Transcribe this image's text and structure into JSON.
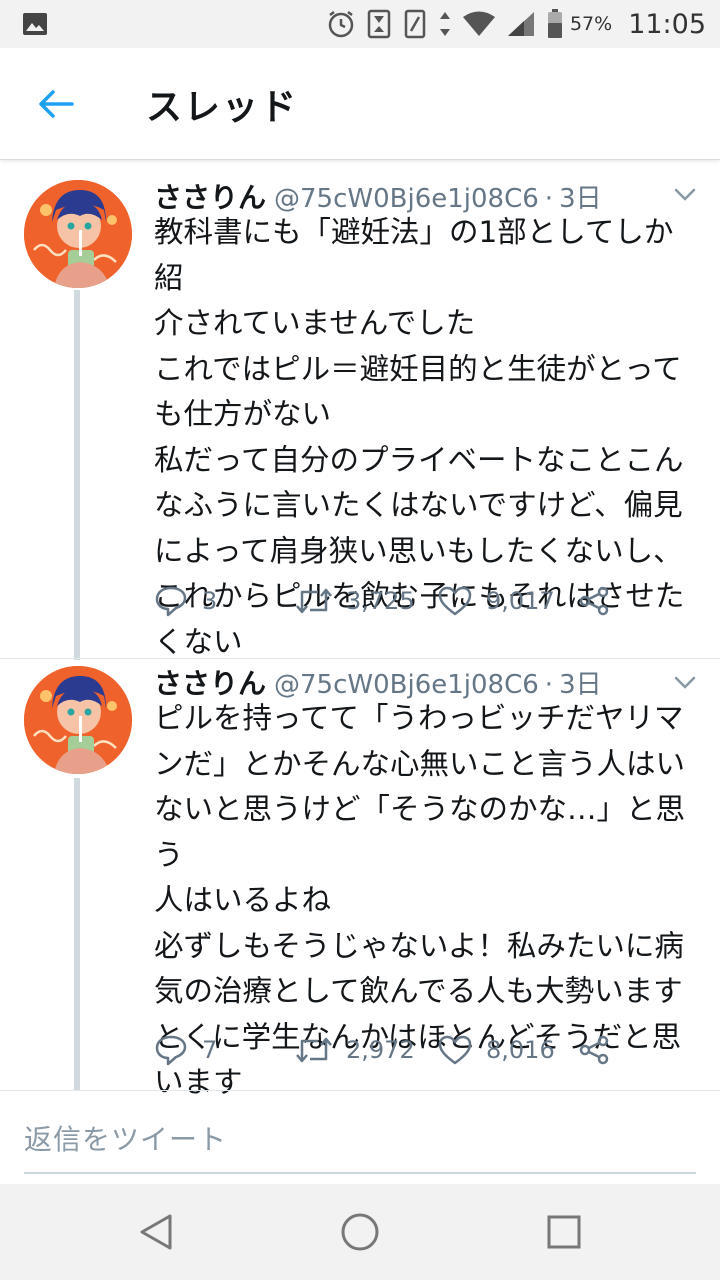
{
  "status_bar": {
    "battery_percent": "57%",
    "time": "11:05",
    "icons": [
      "image-icon",
      "alarm-icon",
      "hourglass-icon",
      "vibrate-icon",
      "data-arrows-icon",
      "wifi-icon",
      "signal-icon",
      "battery-icon"
    ]
  },
  "header": {
    "title": "スレッド",
    "back_icon": "back-arrow-icon",
    "accent_color": "#1da1f2"
  },
  "tweets": [
    {
      "display_name": "ささりん",
      "handle": "@75cW0Bj6e1j08C6",
      "separator": "·",
      "time": "3日",
      "text": "教科書にも「避妊法」の1部としてしか紹\n介されていませんでした\nこれではピル＝避妊目的と生徒がとって\nも仕方がない\n私だって自分のプライベートなことこん\nなふうに言いたくはないですけど、偏見\nによって肩身狭い思いもしたくないし、\nこれからピルを飲む子にもそれはさせた\nくない",
      "replies": "3",
      "retweets": "3,725",
      "likes": "9,017"
    },
    {
      "display_name": "ささりん",
      "handle": "@75cW0Bj6e1j08C6",
      "separator": "·",
      "time": "3日",
      "text": "ピルを持ってて「うわっビッチだヤリマ\nンだ」とかそんな心無いこと言う人はい\nないと思うけど「そうなのかな…」と思う\n人はいるよね\n必ずしもそうじゃないよ！私みたいに病\n気の治療として飲んでる人も大勢います\nとくに学生なんかはほとんどそうだと思\nいます",
      "replies": "7",
      "retweets": "2,972",
      "likes": "8,016"
    }
  ],
  "reply": {
    "placeholder": "返信をツイート"
  },
  "nav": {
    "icons": [
      "back-triangle-icon",
      "home-circle-icon",
      "recents-square-icon"
    ]
  }
}
